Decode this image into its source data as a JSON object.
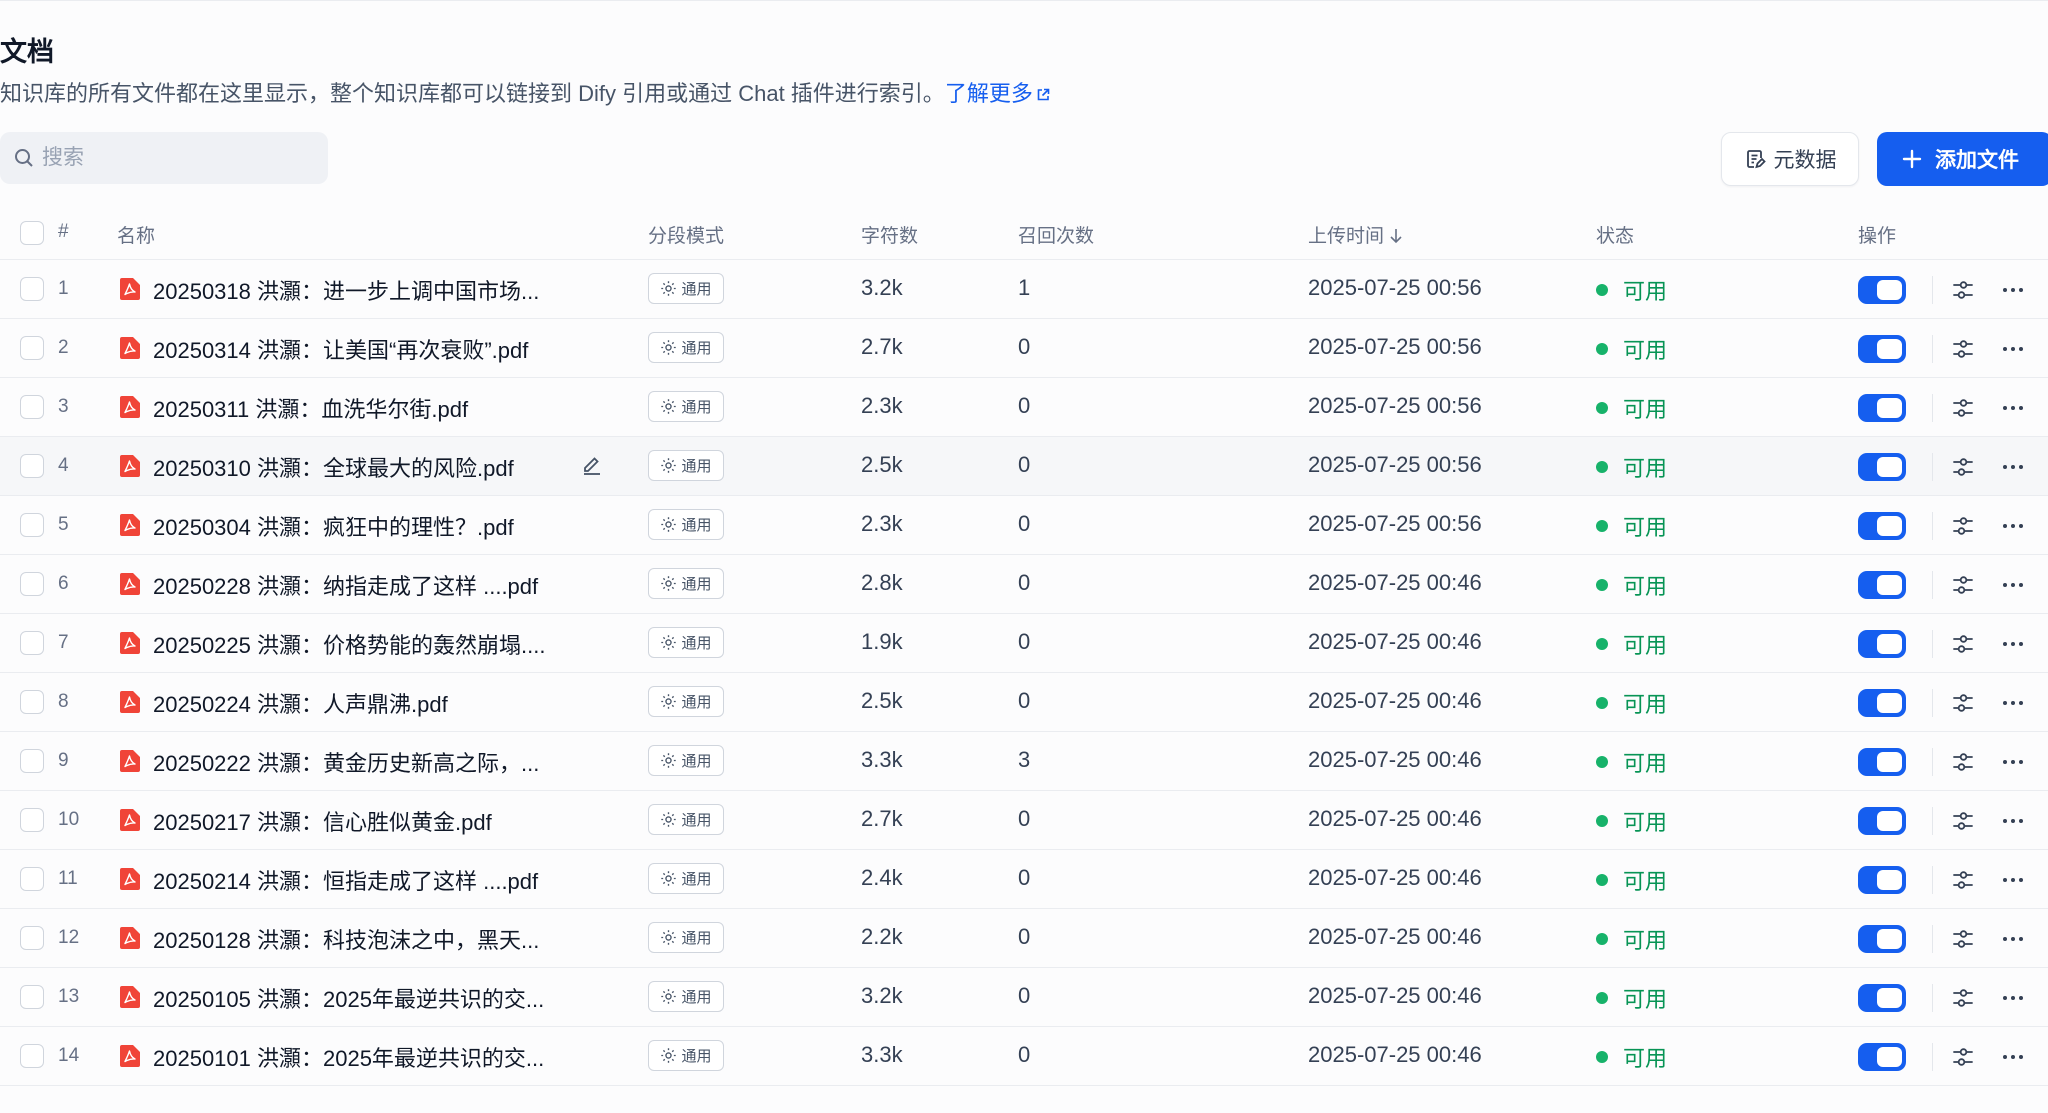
{
  "page": {
    "title": "文档",
    "description": "知识库的所有文件都在这里显示，整个知识库都可以链接到 Dify 引用或通过 Chat 插件进行索引。",
    "learn_more": "了解更多"
  },
  "toolbar": {
    "search_placeholder": "搜索",
    "metadata_button": "元数据",
    "add_button": "添加文件"
  },
  "table": {
    "columns": {
      "index": "#",
      "name": "名称",
      "mode": "分段模式",
      "chars": "字符数",
      "hits": "召回次数",
      "upload_time": "上传时间",
      "status": "状态",
      "actions": "操作"
    },
    "rows": [
      {
        "num": "1",
        "name": "20250318 洪灝：进一步上调中国市场...",
        "mode": "通用",
        "chars": "3.2k",
        "hits": "1",
        "time": "2025-07-25 00:56",
        "status": "可用"
      },
      {
        "num": "2",
        "name": "20250314 洪灝：让美国“再次衰败”.pdf",
        "mode": "通用",
        "chars": "2.7k",
        "hits": "0",
        "time": "2025-07-25 00:56",
        "status": "可用"
      },
      {
        "num": "3",
        "name": "20250311 洪灝：血洗华尔街.pdf",
        "mode": "通用",
        "chars": "2.3k",
        "hits": "0",
        "time": "2025-07-25 00:56",
        "status": "可用"
      },
      {
        "num": "4",
        "name": "20250310 洪灝：全球最大的风险.pdf",
        "mode": "通用",
        "chars": "2.5k",
        "hits": "0",
        "time": "2025-07-25 00:56",
        "status": "可用"
      },
      {
        "num": "5",
        "name": "20250304 洪灝：疯狂中的理性？.pdf",
        "mode": "通用",
        "chars": "2.3k",
        "hits": "0",
        "time": "2025-07-25 00:56",
        "status": "可用"
      },
      {
        "num": "6",
        "name": "20250228 洪灝：纳指走成了这样 ....pdf",
        "mode": "通用",
        "chars": "2.8k",
        "hits": "0",
        "time": "2025-07-25 00:46",
        "status": "可用"
      },
      {
        "num": "7",
        "name": "20250225 洪灝：价格势能的轰然崩塌....",
        "mode": "通用",
        "chars": "1.9k",
        "hits": "0",
        "time": "2025-07-25 00:46",
        "status": "可用"
      },
      {
        "num": "8",
        "name": "20250224 洪灝：人声鼎沸.pdf",
        "mode": "通用",
        "chars": "2.5k",
        "hits": "0",
        "time": "2025-07-25 00:46",
        "status": "可用"
      },
      {
        "num": "9",
        "name": "20250222 洪灝：黄金历史新高之际，...",
        "mode": "通用",
        "chars": "3.3k",
        "hits": "3",
        "time": "2025-07-25 00:46",
        "status": "可用"
      },
      {
        "num": "10",
        "name": "20250217 洪灝：信心胜似黄金.pdf",
        "mode": "通用",
        "chars": "2.7k",
        "hits": "0",
        "time": "2025-07-25 00:46",
        "status": "可用"
      },
      {
        "num": "11",
        "name": "20250214 洪灝：恒指走成了这样 ....pdf",
        "mode": "通用",
        "chars": "2.4k",
        "hits": "0",
        "time": "2025-07-25 00:46",
        "status": "可用"
      },
      {
        "num": "12",
        "name": "20250128 洪灝：科技泡沫之中，黑天...",
        "mode": "通用",
        "chars": "2.2k",
        "hits": "0",
        "time": "2025-07-25 00:46",
        "status": "可用"
      },
      {
        "num": "13",
        "name": "20250105 洪灝：2025年最逆共识的交...",
        "mode": "通用",
        "chars": "3.2k",
        "hits": "0",
        "time": "2025-07-25 00:46",
        "status": "可用"
      },
      {
        "num": "14",
        "name": "20250101 洪灝：2025年最逆共识的交...",
        "mode": "通用",
        "chars": "3.3k",
        "hits": "0",
        "time": "2025-07-25 00:46",
        "status": "可用"
      }
    ]
  },
  "colors": {
    "accent": "#155eef",
    "status_ok": "#17b26a",
    "pdf_red": "#f04438"
  }
}
